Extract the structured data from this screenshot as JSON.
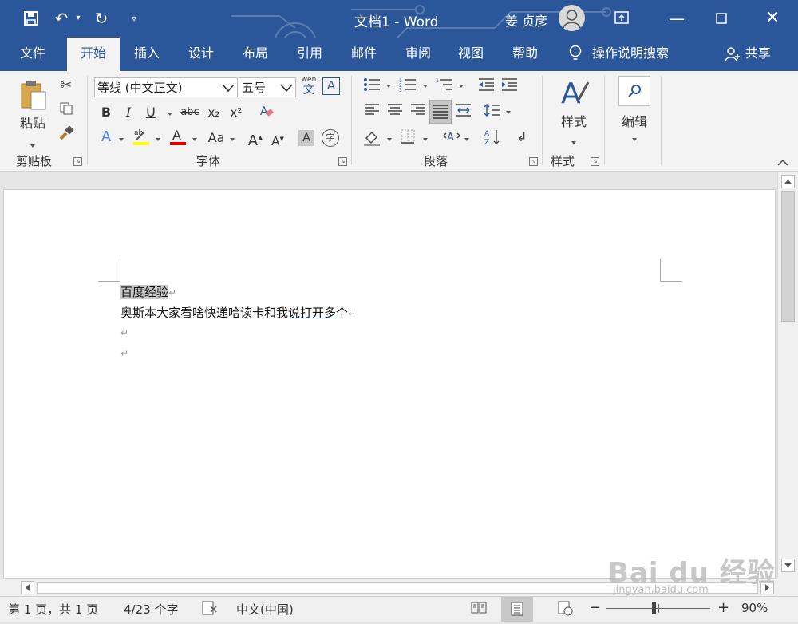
{
  "titlebar": {
    "doc_title": "文档1  -  Word",
    "user_name": "姜 贞彦",
    "accent_color": "#2b579a"
  },
  "tabs": [
    {
      "label": "文件"
    },
    {
      "label": "开始"
    },
    {
      "label": "插入"
    },
    {
      "label": "设计"
    },
    {
      "label": "布局"
    },
    {
      "label": "引用"
    },
    {
      "label": "邮件"
    },
    {
      "label": "审阅"
    },
    {
      "label": "视图"
    },
    {
      "label": "帮助"
    }
  ],
  "tell_me": "操作说明搜索",
  "share": "共享",
  "ribbon": {
    "clipboard": {
      "paste": "粘贴",
      "label": "剪贴板"
    },
    "font": {
      "font_name": "等线 (中文正文)",
      "font_size": "五号",
      "wen": "wén",
      "wen_char": "文",
      "bold": "B",
      "italic": "I",
      "underline": "U",
      "strike": "abc",
      "sub": "x₂",
      "sup": "x²",
      "aa": "Aa",
      "label": "字体"
    },
    "paragraph": {
      "label": "段落"
    },
    "styles": {
      "button": "样式",
      "label": "样式"
    },
    "editing": {
      "button": "编辑"
    }
  },
  "document": {
    "lines": [
      {
        "text": "百度经验",
        "highlighted": true
      },
      {
        "text_plain": "奥斯本大家看啥快递哈读卡和我",
        "text_underlined": "说打开多",
        "text_tail": "个"
      },
      {
        "text": ""
      },
      {
        "text": ""
      }
    ],
    "para_mark": "↵"
  },
  "statusbar": {
    "page": "第 1 页，共 1 页",
    "words": "4/23 个字",
    "language": "中文(中国)",
    "zoom": "90%",
    "zoom_minus": "−",
    "zoom_plus": "+"
  },
  "watermark": {
    "text": "Bai du 经验",
    "url": "jingyan.baidu.com"
  },
  "icons": [
    "save-icon",
    "undo-icon",
    "redo-icon",
    "customize-icon",
    "ribbon-display-icon",
    "minimize-icon",
    "maximize-icon",
    "close-icon",
    "lightbulb-icon",
    "share-icon",
    "search-icon"
  ]
}
